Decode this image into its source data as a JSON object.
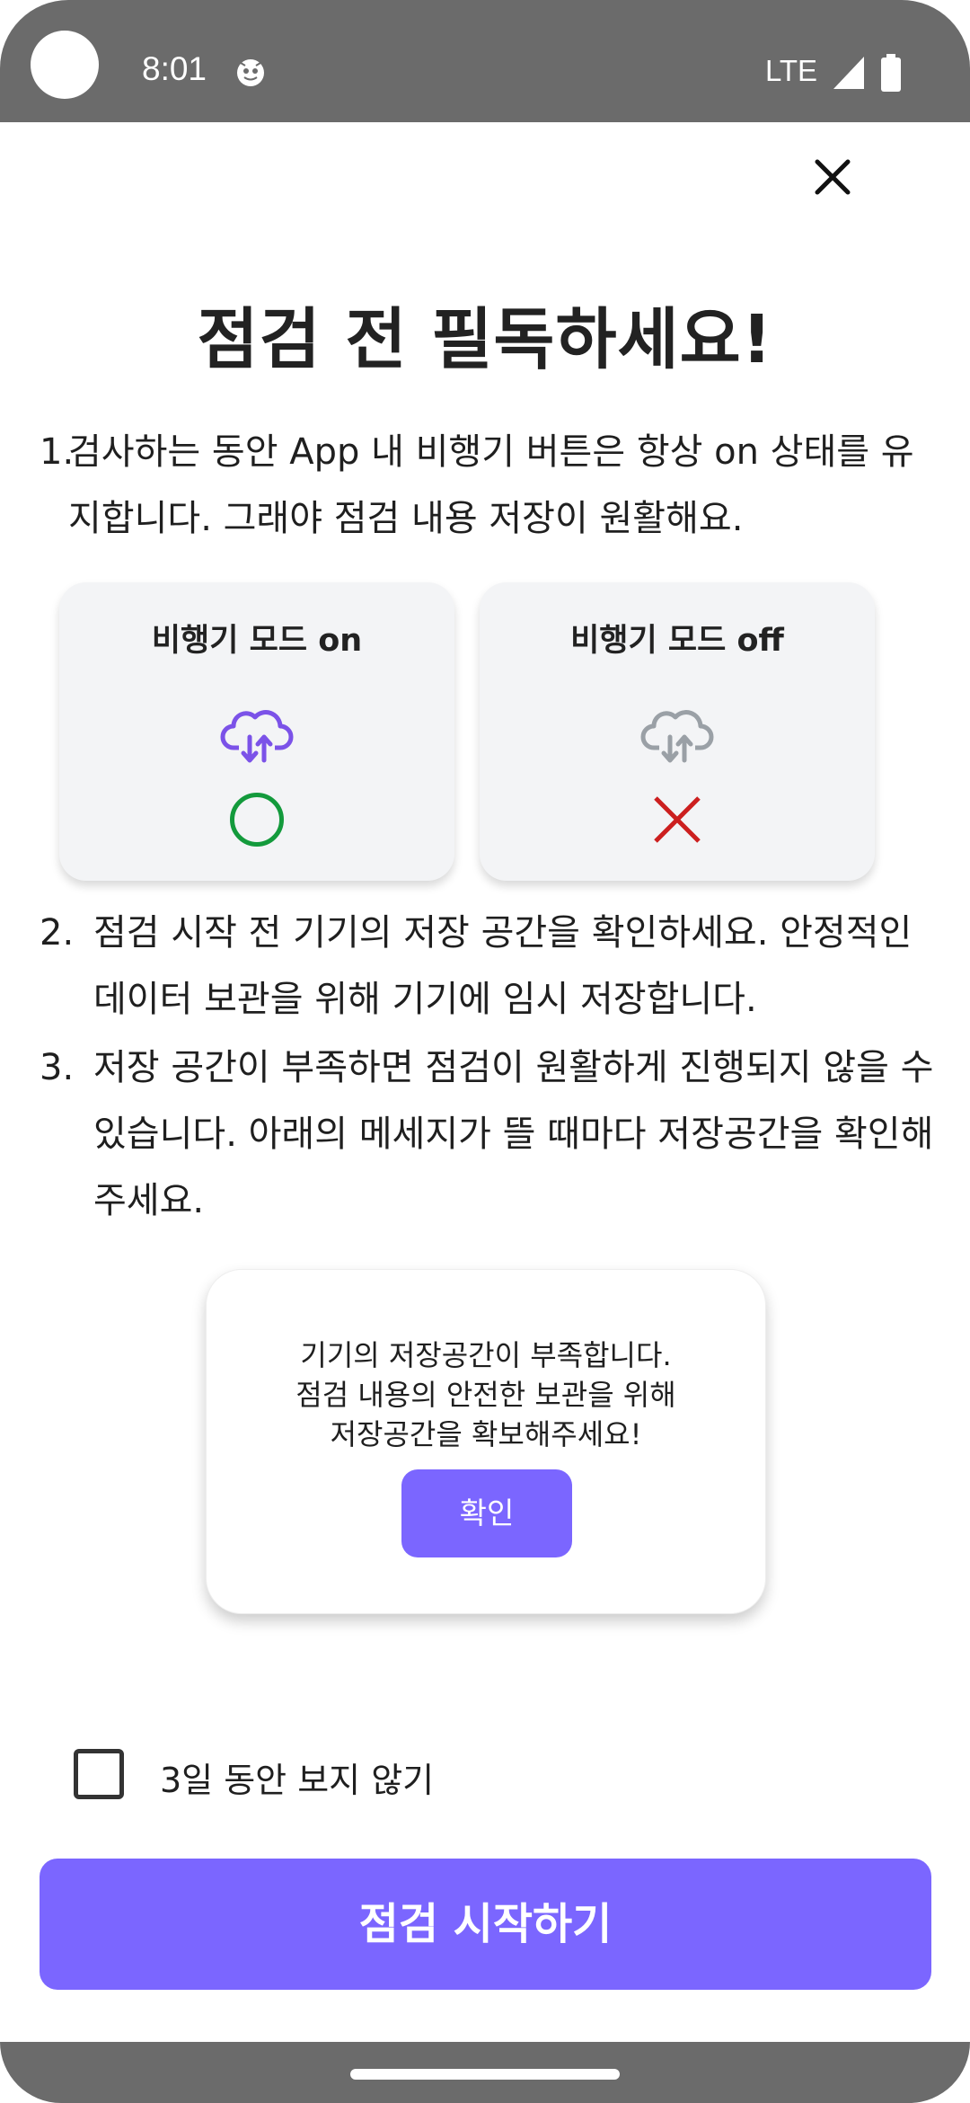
{
  "status_bar": {
    "time": "8:01",
    "network": "LTE",
    "notification_icon": "app-notification-icon",
    "signal_icon": "signal-icon",
    "battery_icon": "battery-icon"
  },
  "close_icon": "close-icon",
  "title": "점검 전 필독하세요!",
  "items": [
    {
      "number": "1.",
      "text": "검사하는 동안 App 내 비행기 버튼은 항상 on 상태를 유지합니다. 그래야 점검 내용 저장이 원활해요."
    },
    {
      "number": "2.",
      "text": "점검 시작 전 기기의 저장 공간을 확인하세요. 안정적인 데이터 보관을 위해 기기에 임시 저장합니다."
    },
    {
      "number": "3.",
      "text": "저장 공간이 부족하면 점검이 원활하게 진행되지 않을 수 있습니다. 아래의 메세지가 뜰 때마다 저장공간을 확인해주세요."
    }
  ],
  "mode_cards": [
    {
      "title": "비행기 모드 on",
      "icon": "cloud-sync-icon",
      "mark": "circle-check-icon",
      "color": "#7b52e8"
    },
    {
      "title": "비행기 모드 off",
      "icon": "cloud-sync-icon",
      "mark": "x-mark-icon",
      "color": "#9aa0a6"
    }
  ],
  "sample_dialog": {
    "lines": [
      "기기의 저장공간이 부족합니다.",
      "점검 내용의 안전한 보관을 위해",
      "저장공간을 확보해주세요!"
    ],
    "confirm_label": "확인"
  },
  "checkbox": {
    "label": "3일 동안 보지 않기",
    "checked": false
  },
  "start_button_label": "점검 시작하기",
  "colors": {
    "accent": "#7b66ff",
    "status_bar": "#6b6b6b",
    "success": "#139a3c",
    "error": "#cc1f1f",
    "card_bg": "#f3f4f6"
  }
}
